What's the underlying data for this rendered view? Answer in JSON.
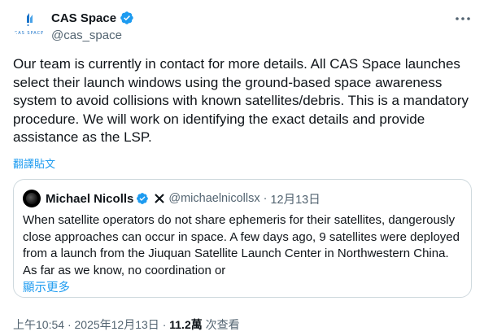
{
  "author": {
    "display_name": "CAS Space",
    "handle": "@cas_space",
    "avatar_text": "CAS SPACE"
  },
  "tweet": {
    "text": "Our team is currently in contact for more details. All CAS Space launches select their launch windows using the ground-based space awareness system to avoid collisions with known satellites/debris. This is a mandatory procedure. We will work on identifying the exact details and provide assistance as the LSP.",
    "translate_label": "翻譯貼文"
  },
  "quote": {
    "display_name": "Michael Nicolls",
    "handle": "@michaelnicollsx",
    "separator": "·",
    "date": "12月13日",
    "text": "When satellite operators do not share ephemeris for their satellites, dangerously close approaches can occur in space.   A few days ago, 9 satellites were deployed from a launch from the Jiuquan Satellite Launch Center in Northwestern China.  As far as we know, no coordination or",
    "show_more": "顯示更多"
  },
  "meta": {
    "time": "上午10:54",
    "sep1": "·",
    "date": "2025年12月13日",
    "sep2": "·",
    "views_count": "11.2萬",
    "views_label": "次查看"
  },
  "colors": {
    "accent": "#1d9bf0",
    "text": "#0f1419",
    "secondary": "#536471",
    "border": "#cfd9de"
  }
}
